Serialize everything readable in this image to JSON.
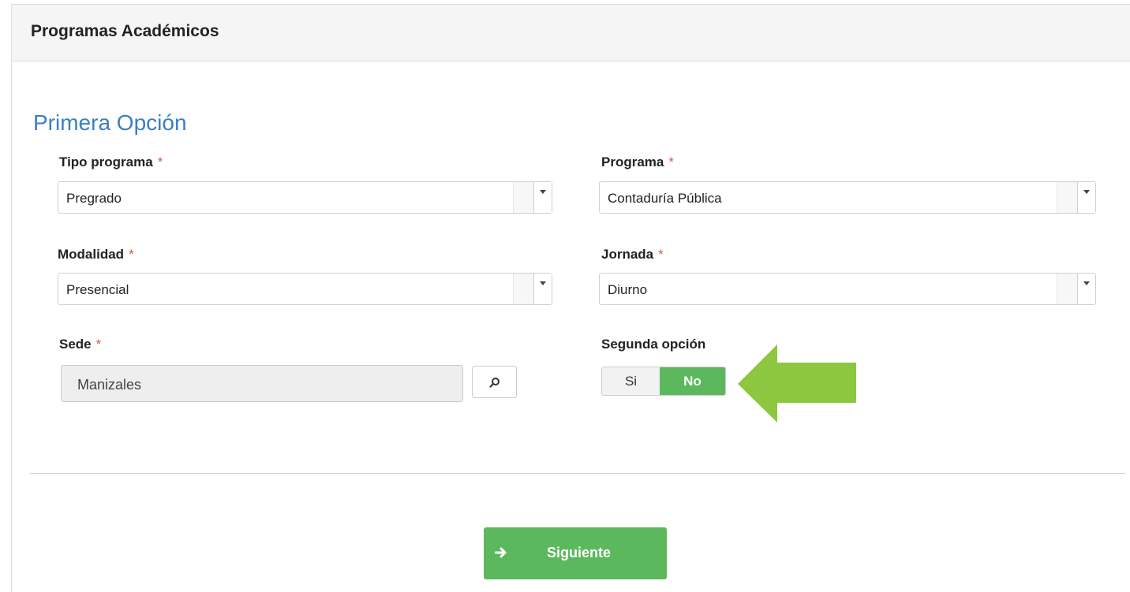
{
  "panel": {
    "title": "Programas Académicos"
  },
  "section": {
    "title": "Primera Opción"
  },
  "required_mark": "*",
  "fields": {
    "tipo_programa": {
      "label": "Tipo programa",
      "value": "Pregrado"
    },
    "programa": {
      "label": "Programa",
      "value": "Contaduría Pública"
    },
    "modalidad": {
      "label": "Modalidad",
      "value": "Presencial"
    },
    "jornada": {
      "label": "Jornada",
      "value": "Diurno"
    },
    "sede": {
      "label": "Sede",
      "value": "Manizales",
      "icon": "search-icon"
    },
    "segunda_opcion": {
      "label": "Segunda opción",
      "off_label": "Si",
      "on_label": "No",
      "selected": "No"
    }
  },
  "actions": {
    "next_label": "Siguiente",
    "next_icon": "arrow-right-icon"
  },
  "colors": {
    "accent_green": "#5cb85c",
    "title_blue": "#3a7fc1",
    "required_red": "#d9534f",
    "annotation_arrow": "#8dc63f"
  }
}
